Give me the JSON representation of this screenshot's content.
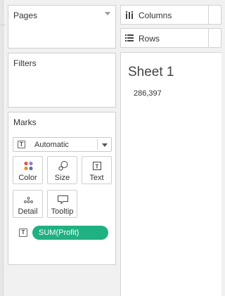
{
  "cards": {
    "pages": {
      "title": "Pages"
    },
    "filters": {
      "title": "Filters"
    },
    "marks": {
      "title": "Marks",
      "mark_type": "Automatic",
      "buttons": {
        "color": "Color",
        "size": "Size",
        "text": "Text",
        "detail": "Detail",
        "tooltip": "Tooltip"
      },
      "pill": {
        "label": "SUM(Profit)",
        "color": "#1fb182"
      }
    }
  },
  "shelves": {
    "columns": {
      "label": "Columns",
      "icon": "columns-icon"
    },
    "rows": {
      "label": "Rows",
      "icon": "rows-icon"
    }
  },
  "sheet": {
    "title": "Sheet 1",
    "value": "286,397"
  }
}
